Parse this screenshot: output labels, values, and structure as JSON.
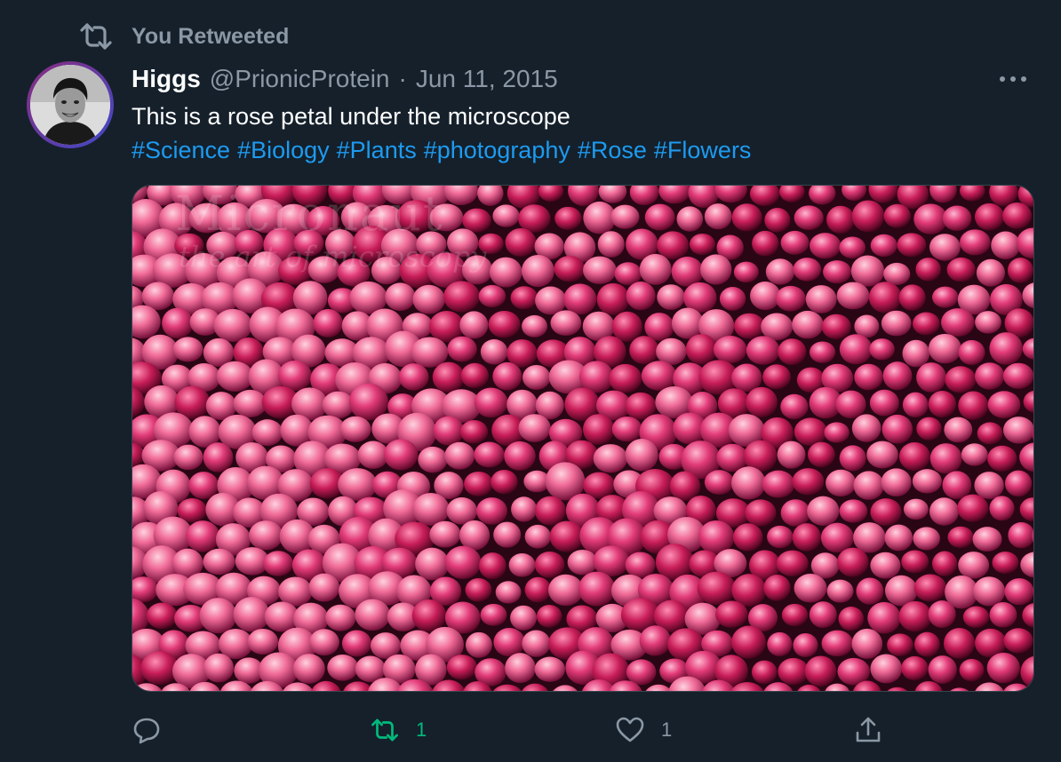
{
  "retweet_context": {
    "label": "You Retweeted",
    "icon": "retweet-icon"
  },
  "author": {
    "name": "Higgs",
    "handle": "@PrionicProtein",
    "separator": "·",
    "date": "Jun 11, 2015"
  },
  "tweet": {
    "text": "This is a rose petal under the microscope",
    "hashtags": [
      "#Science",
      "#Biology",
      "#Plants",
      "#photography",
      "#Rose",
      "#Flowers"
    ]
  },
  "media": {
    "watermark_brand": "Micronaut",
    "watermark_tagline": "the art of microscopy"
  },
  "actions": {
    "replies": "",
    "retweets": "1",
    "likes": "1"
  },
  "colors": {
    "background": "#15202b",
    "secondary_text": "#8b98a5",
    "link": "#1d9bf0",
    "retweet_active": "#00ba7c"
  }
}
